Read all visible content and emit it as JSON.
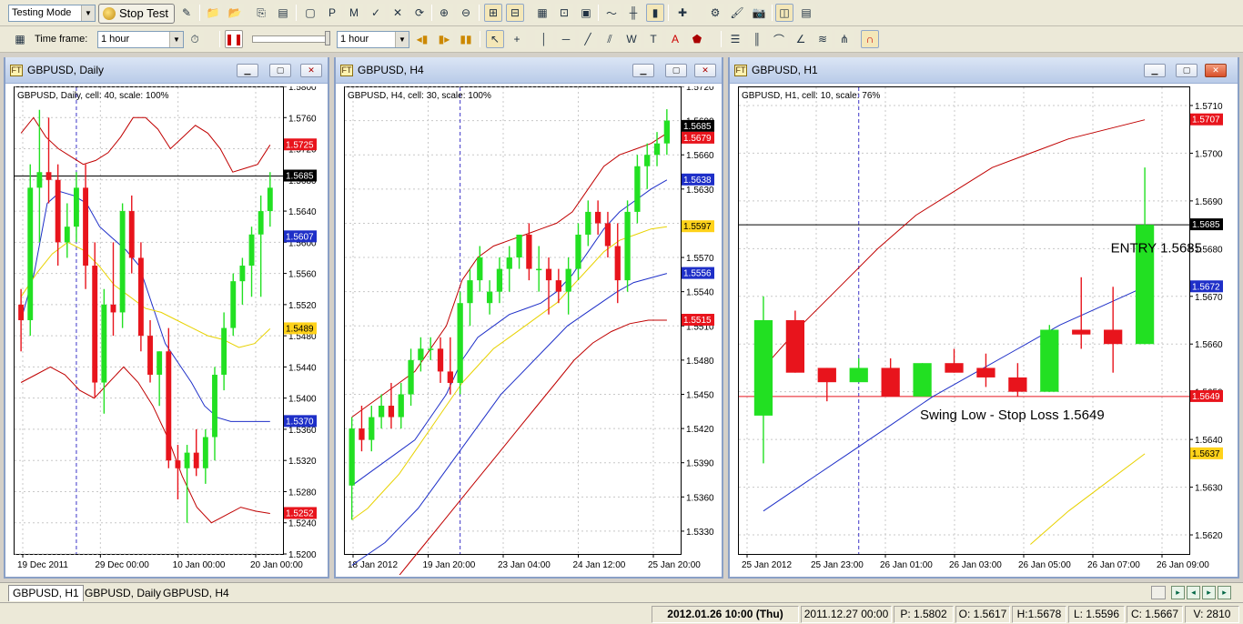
{
  "toolbar": {
    "mode_select": "Testing Mode",
    "stop_test_label": "Stop Test",
    "timeframe_label": "Time frame:",
    "timeframe_value": "1 hour",
    "period_value": "1 hour"
  },
  "windows": [
    {
      "title": "GBPUSD, Daily",
      "info": "GBPUSD, Daily, cell: 40, scale: 100%",
      "y_min": 1.52,
      "y_max": 1.58,
      "y_ticks": [
        "1.5800",
        "1.5760",
        "1.5720",
        "1.5680",
        "1.5640",
        "1.5600",
        "1.5560",
        "1.5520",
        "1.5480",
        "1.5440",
        "1.5400",
        "1.5360",
        "1.5320",
        "1.5280",
        "1.5240",
        "1.5200"
      ],
      "x_labels": [
        "19 Dec 2011",
        "29 Dec 00:00",
        "10 Jan 00:00",
        "20 Jan 00:00"
      ],
      "price_tags": [
        {
          "value": 1.5725,
          "text": "1.5725",
          "color": "#e8141c",
          "fg": "#ffffff"
        },
        {
          "value": 1.5685,
          "text": "1.5685",
          "color": "#000000",
          "fg": "#ffffff"
        },
        {
          "value": 1.5607,
          "text": "1.5607",
          "color": "#1e2fc8",
          "fg": "#ffffff"
        },
        {
          "value": 1.5489,
          "text": "1.5489",
          "color": "#ffd21a",
          "fg": "#000000"
        },
        {
          "value": 1.537,
          "text": "1.5370",
          "color": "#1e2fc8",
          "fg": "#ffffff"
        },
        {
          "value": 1.5252,
          "text": "1.5252",
          "color": "#e8141c",
          "fg": "#ffffff"
        }
      ],
      "h_line": 1.5685,
      "candles": [
        {
          "o": 1.552,
          "h": 1.554,
          "l": 1.546,
          "c": 1.55
        },
        {
          "o": 1.55,
          "h": 1.57,
          "l": 1.548,
          "c": 1.567
        },
        {
          "o": 1.567,
          "h": 1.577,
          "l": 1.56,
          "c": 1.569
        },
        {
          "o": 1.569,
          "h": 1.576,
          "l": 1.565,
          "c": 1.568
        },
        {
          "o": 1.568,
          "h": 1.57,
          "l": 1.557,
          "c": 1.56
        },
        {
          "o": 1.56,
          "h": 1.565,
          "l": 1.558,
          "c": 1.562
        },
        {
          "o": 1.562,
          "h": 1.569,
          "l": 1.56,
          "c": 1.567
        },
        {
          "o": 1.567,
          "h": 1.57,
          "l": 1.554,
          "c": 1.557
        },
        {
          "o": 1.557,
          "h": 1.56,
          "l": 1.54,
          "c": 1.542
        },
        {
          "o": 1.542,
          "h": 1.554,
          "l": 1.538,
          "c": 1.552
        },
        {
          "o": 1.552,
          "h": 1.56,
          "l": 1.548,
          "c": 1.551
        },
        {
          "o": 1.551,
          "h": 1.565,
          "l": 1.549,
          "c": 1.564
        },
        {
          "o": 1.564,
          "h": 1.566,
          "l": 1.556,
          "c": 1.558
        },
        {
          "o": 1.558,
          "h": 1.56,
          "l": 1.546,
          "c": 1.548
        },
        {
          "o": 1.548,
          "h": 1.55,
          "l": 1.542,
          "c": 1.543
        },
        {
          "o": 1.543,
          "h": 1.546,
          "l": 1.539,
          "c": 1.546
        },
        {
          "o": 1.546,
          "h": 1.549,
          "l": 1.531,
          "c": 1.532
        },
        {
          "o": 1.532,
          "h": 1.534,
          "l": 1.527,
          "c": 1.531
        },
        {
          "o": 1.531,
          "h": 1.534,
          "l": 1.524,
          "c": 1.533
        },
        {
          "o": 1.533,
          "h": 1.536,
          "l": 1.53,
          "c": 1.531
        },
        {
          "o": 1.531,
          "h": 1.536,
          "l": 1.529,
          "c": 1.535
        },
        {
          "o": 1.535,
          "h": 1.544,
          "l": 1.532,
          "c": 1.543
        },
        {
          "o": 1.543,
          "h": 1.551,
          "l": 1.541,
          "c": 1.549
        },
        {
          "o": 1.549,
          "h": 1.556,
          "l": 1.548,
          "c": 1.555
        },
        {
          "o": 1.555,
          "h": 1.558,
          "l": 1.552,
          "c": 1.557
        },
        {
          "o": 1.557,
          "h": 1.562,
          "l": 1.553,
          "c": 1.561
        },
        {
          "o": 1.561,
          "h": 1.566,
          "l": 1.553,
          "c": 1.564
        },
        {
          "o": 1.564,
          "h": 1.569,
          "l": 1.562,
          "c": 1.567
        }
      ],
      "lines": [
        {
          "color": "#c00000",
          "values": [
            1.574,
            1.576,
            1.5735,
            1.572,
            1.571,
            1.57,
            1.5705,
            1.5715,
            1.5735,
            1.576,
            1.576,
            1.5745,
            1.572,
            1.5735,
            1.575,
            1.574,
            1.572,
            1.569,
            1.5695,
            1.57,
            1.5725
          ]
        },
        {
          "color": "#1e2fc8",
          "values": [
            1.55,
            1.556,
            1.565,
            1.5665,
            1.566,
            1.565,
            1.562,
            1.5605,
            1.559,
            1.557,
            1.552,
            1.547,
            1.5445,
            1.542,
            1.539,
            1.5375,
            1.537,
            1.537,
            1.537,
            1.537
          ]
        },
        {
          "color": "#e8d200",
          "values": [
            1.553,
            1.556,
            1.5585,
            1.56,
            1.559,
            1.557,
            1.5545,
            1.553,
            1.5515,
            1.551,
            1.55,
            1.549,
            1.548,
            1.5475,
            1.5465,
            1.547,
            1.5489
          ]
        },
        {
          "color": "#c00000",
          "values": [
            1.542,
            1.543,
            1.544,
            1.543,
            1.541,
            1.54,
            1.542,
            1.544,
            1.542,
            1.539,
            1.535,
            1.53,
            1.526,
            1.524,
            1.525,
            1.526,
            1.5255,
            1.5252
          ]
        }
      ],
      "vline_index": 6
    },
    {
      "title": "GBPUSD, H4",
      "info": "GBPUSD, H4, cell: 30, scale: 100%",
      "y_min": 1.531,
      "y_max": 1.572,
      "y_ticks": [
        "1.5720",
        "1.5690",
        "1.5660",
        "1.5630",
        "1.5600",
        "1.5570",
        "1.5540",
        "1.5510",
        "1.5480",
        "1.5450",
        "1.5420",
        "1.5390",
        "1.5360",
        "1.5330"
      ],
      "x_labels": [
        "18 Jan 2012",
        "19 Jan 20:00",
        "23 Jan 04:00",
        "24 Jan 12:00",
        "25 Jan 20:00"
      ],
      "price_tags": [
        {
          "value": 1.5685,
          "text": "1.5685",
          "color": "#000000",
          "fg": "#ffffff"
        },
        {
          "value": 1.5679,
          "text": "1.5679",
          "color": "#e8141c",
          "fg": "#ffffff"
        },
        {
          "value": 1.5638,
          "text": "1.5638",
          "color": "#1e2fc8",
          "fg": "#ffffff"
        },
        {
          "value": 1.5597,
          "text": "1.5597",
          "color": "#ffd21a",
          "fg": "#000000"
        },
        {
          "value": 1.5556,
          "text": "1.5556",
          "color": "#1e2fc8",
          "fg": "#ffffff"
        },
        {
          "value": 1.5515,
          "text": "1.5515",
          "color": "#e8141c",
          "fg": "#ffffff"
        }
      ],
      "h_line": null,
      "candles": [
        {
          "o": 1.537,
          "h": 1.543,
          "l": 1.534,
          "c": 1.542
        },
        {
          "o": 1.542,
          "h": 1.544,
          "l": 1.54,
          "c": 1.541
        },
        {
          "o": 1.541,
          "h": 1.544,
          "l": 1.54,
          "c": 1.543
        },
        {
          "o": 1.543,
          "h": 1.545,
          "l": 1.542,
          "c": 1.544
        },
        {
          "o": 1.544,
          "h": 1.546,
          "l": 1.542,
          "c": 1.543
        },
        {
          "o": 1.543,
          "h": 1.546,
          "l": 1.542,
          "c": 1.545
        },
        {
          "o": 1.545,
          "h": 1.549,
          "l": 1.544,
          "c": 1.548
        },
        {
          "o": 1.548,
          "h": 1.55,
          "l": 1.547,
          "c": 1.549
        },
        {
          "o": 1.549,
          "h": 1.55,
          "l": 1.548,
          "c": 1.549
        },
        {
          "o": 1.549,
          "h": 1.55,
          "l": 1.546,
          "c": 1.547
        },
        {
          "o": 1.547,
          "h": 1.55,
          "l": 1.545,
          "c": 1.546
        },
        {
          "o": 1.546,
          "h": 1.554,
          "l": 1.545,
          "c": 1.553
        },
        {
          "o": 1.553,
          "h": 1.556,
          "l": 1.551,
          "c": 1.555
        },
        {
          "o": 1.555,
          "h": 1.558,
          "l": 1.554,
          "c": 1.557
        },
        {
          "o": 1.553,
          "h": 1.555,
          "l": 1.552,
          "c": 1.554
        },
        {
          "o": 1.554,
          "h": 1.557,
          "l": 1.553,
          "c": 1.556
        },
        {
          "o": 1.556,
          "h": 1.558,
          "l": 1.554,
          "c": 1.557
        },
        {
          "o": 1.557,
          "h": 1.559,
          "l": 1.556,
          "c": 1.559
        },
        {
          "o": 1.559,
          "h": 1.56,
          "l": 1.555,
          "c": 1.556
        },
        {
          "o": 1.556,
          "h": 1.558,
          "l": 1.554,
          "c": 1.556
        },
        {
          "o": 1.556,
          "h": 1.557,
          "l": 1.552,
          "c": 1.555
        },
        {
          "o": 1.555,
          "h": 1.556,
          "l": 1.553,
          "c": 1.554
        },
        {
          "o": 1.554,
          "h": 1.557,
          "l": 1.552,
          "c": 1.556
        },
        {
          "o": 1.556,
          "h": 1.56,
          "l": 1.555,
          "c": 1.559
        },
        {
          "o": 1.559,
          "h": 1.562,
          "l": 1.558,
          "c": 1.561
        },
        {
          "o": 1.561,
          "h": 1.562,
          "l": 1.559,
          "c": 1.56
        },
        {
          "o": 1.56,
          "h": 1.561,
          "l": 1.557,
          "c": 1.558
        },
        {
          "o": 1.558,
          "h": 1.56,
          "l": 1.553,
          "c": 1.555
        },
        {
          "o": 1.555,
          "h": 1.562,
          "l": 1.554,
          "c": 1.561
        },
        {
          "o": 1.561,
          "h": 1.566,
          "l": 1.56,
          "c": 1.565
        },
        {
          "o": 1.565,
          "h": 1.567,
          "l": 1.563,
          "c": 1.566
        },
        {
          "o": 1.566,
          "h": 1.568,
          "l": 1.565,
          "c": 1.567
        },
        {
          "o": 1.567,
          "h": 1.57,
          "l": 1.566,
          "c": 1.569
        }
      ],
      "lines": [
        {
          "color": "#c00000",
          "values": [
            1.543,
            1.544,
            1.545,
            1.546,
            1.547,
            1.549,
            1.551,
            1.555,
            1.557,
            1.558,
            1.5585,
            1.559,
            1.5595,
            1.56,
            1.561,
            1.563,
            1.565,
            1.566,
            1.5665,
            1.567,
            1.5679
          ]
        },
        {
          "color": "#1e2fc8",
          "values": [
            1.537,
            1.538,
            1.539,
            1.54,
            1.541,
            1.543,
            1.545,
            1.548,
            1.55,
            1.551,
            1.552,
            1.5525,
            1.553,
            1.554,
            1.5555,
            1.5575,
            1.5595,
            1.561,
            1.562,
            1.563,
            1.5638
          ]
        },
        {
          "color": "#e8d200",
          "values": [
            1.534,
            1.535,
            1.5365,
            1.538,
            1.54,
            1.542,
            1.544,
            1.546,
            1.5475,
            1.549,
            1.55,
            1.551,
            1.552,
            1.553,
            1.5545,
            1.556,
            1.5575,
            1.5585,
            1.559,
            1.5595,
            1.5597
          ]
        },
        {
          "color": "#1e2fc8",
          "values": [
            1.53,
            1.531,
            1.532,
            1.5335,
            1.535,
            1.537,
            1.539,
            1.541,
            1.543,
            1.545,
            1.5465,
            1.548,
            1.5495,
            1.551,
            1.552,
            1.553,
            1.554,
            1.5548,
            1.5552,
            1.5556
          ]
        },
        {
          "color": "#c00000",
          "values": [
            1.524,
            1.526,
            1.528,
            1.53,
            1.532,
            1.534,
            1.536,
            1.538,
            1.54,
            1.542,
            1.544,
            1.546,
            1.548,
            1.5495,
            1.5505,
            1.5512,
            1.5515,
            1.5515
          ]
        }
      ],
      "vline_index": 11
    },
    {
      "title": "GBPUSD, H1",
      "info": "GBPUSD, H1, cell: 10, scale: 76%",
      "y_min": 1.5616,
      "y_max": 1.5714,
      "y_ticks": [
        "1.5710",
        "1.5700",
        "1.5690",
        "1.5680",
        "1.5670",
        "1.5660",
        "1.5650",
        "1.5640",
        "1.5630",
        "1.5620"
      ],
      "x_labels": [
        "25 Jan 2012",
        "25 Jan 23:00",
        "26 Jan 01:00",
        "26 Jan 03:00",
        "26 Jan 05:00",
        "26 Jan 07:00",
        "26 Jan 09:00"
      ],
      "price_tags": [
        {
          "value": 1.5707,
          "text": "1.5707",
          "color": "#e8141c",
          "fg": "#ffffff"
        },
        {
          "value": 1.5685,
          "text": "1.5685",
          "color": "#000000",
          "fg": "#ffffff"
        },
        {
          "value": 1.5672,
          "text": "1.5672",
          "color": "#1e2fc8",
          "fg": "#ffffff"
        },
        {
          "value": 1.5649,
          "text": "1.5649",
          "color": "#e8141c",
          "fg": "#ffffff"
        },
        {
          "value": 1.5637,
          "text": "1.5637",
          "color": "#ffd21a",
          "fg": "#000000"
        }
      ],
      "h_line": 1.5685,
      "h_line2": 1.5649,
      "annotations": [
        {
          "text": "ENTRY 1.5685",
          "value": 1.568,
          "index": 11.5
        },
        {
          "text": "Swing Low - Stop Loss 1.5649",
          "value": 1.5645,
          "index": 5.5
        }
      ],
      "candles": [
        {
          "o": 1.5645,
          "h": 1.567,
          "l": 1.5635,
          "c": 1.5665
        },
        {
          "o": 1.5665,
          "h": 1.5667,
          "l": 1.5654,
          "c": 1.5654
        },
        {
          "o": 1.5655,
          "h": 1.5655,
          "l": 1.5648,
          "c": 1.5652
        },
        {
          "o": 1.5652,
          "h": 1.5657,
          "l": 1.5652,
          "c": 1.5655
        },
        {
          "o": 1.5655,
          "h": 1.5657,
          "l": 1.5649,
          "c": 1.5649
        },
        {
          "o": 1.5649,
          "h": 1.5656,
          "l": 1.5649,
          "c": 1.5656
        },
        {
          "o": 1.5656,
          "h": 1.5659,
          "l": 1.5654,
          "c": 1.5654
        },
        {
          "o": 1.5655,
          "h": 1.5658,
          "l": 1.5651,
          "c": 1.5653
        },
        {
          "o": 1.5653,
          "h": 1.5656,
          "l": 1.5649,
          "c": 1.565
        },
        {
          "o": 1.565,
          "h": 1.5664,
          "l": 1.565,
          "c": 1.5663
        },
        {
          "o": 1.5663,
          "h": 1.5674,
          "l": 1.5659,
          "c": 1.5662
        },
        {
          "o": 1.5663,
          "h": 1.5672,
          "l": 1.5654,
          "c": 1.566
        },
        {
          "o": 1.566,
          "h": 1.5697,
          "l": 1.566,
          "c": 1.5685
        }
      ],
      "lines": [
        {
          "color": "#c00000",
          "values": [
            1.5655,
            1.5664,
            1.5672,
            1.568,
            1.5687,
            1.5692,
            1.5697,
            1.57,
            1.5703,
            1.5705,
            1.5707
          ]
        },
        {
          "color": "#1e2fc8",
          "values": [
            1.5625,
            1.5631,
            1.5637,
            1.5643,
            1.5649,
            1.5654,
            1.5659,
            1.5664,
            1.5668,
            1.5672
          ]
        },
        {
          "color": "#e8d200",
          "values": [
            null,
            null,
            null,
            null,
            null,
            null,
            null,
            1.5618,
            1.5625,
            1.5631,
            1.5637
          ]
        }
      ],
      "vline_index": 3
    }
  ],
  "tabs": [
    "GBPUSD, H1",
    "GBPUSD, Daily",
    "GBPUSD, H4"
  ],
  "status": {
    "datetime": "2012.01.26 10:00 (Thu)",
    "bar_time": "2011.12.27 00:00",
    "p": "P: 1.5802",
    "o": "O: 1.5617",
    "h": "H:1.5678",
    "l": "L: 1.5596",
    "c": "C: 1.5667",
    "v": "V: 2810"
  },
  "colors": {
    "bull": "#22e022",
    "bear": "#e8141c",
    "grid": "#c8c8c8"
  }
}
